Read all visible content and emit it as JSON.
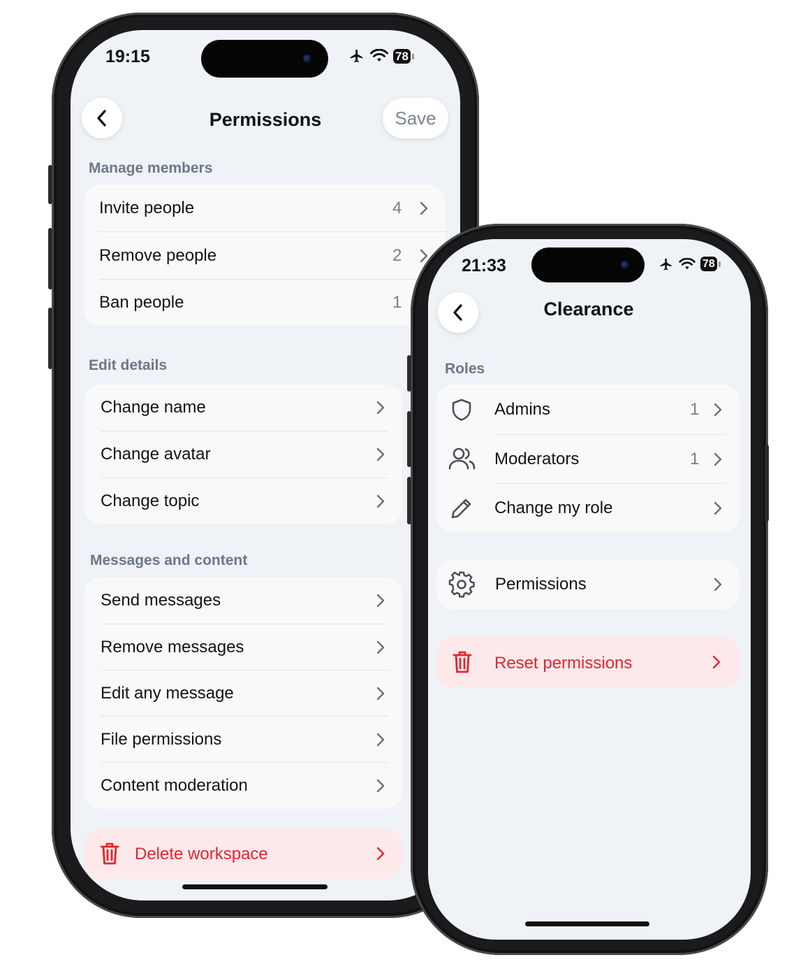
{
  "colors": {
    "danger": "#e3262e",
    "screen_bg": "#eff2f6",
    "card_bg": "#f9f9fa",
    "muted": "#6c7789"
  },
  "left_phone": {
    "status_time": "19:15",
    "battery": "78",
    "title": "Permissions",
    "save_label": "Save",
    "sections": [
      {
        "label": "Manage members",
        "items": [
          {
            "label": "Invite people",
            "count": "4"
          },
          {
            "label": "Remove people",
            "count": "2"
          },
          {
            "label": "Ban people",
            "count": "1"
          }
        ]
      },
      {
        "label": "Edit details",
        "items": [
          {
            "label": "Change name"
          },
          {
            "label": "Change avatar"
          },
          {
            "label": "Change topic"
          }
        ]
      },
      {
        "label": "Messages and content",
        "items": [
          {
            "label": "Send messages"
          },
          {
            "label": "Remove messages"
          },
          {
            "label": "Edit any message"
          },
          {
            "label": "File permissions"
          },
          {
            "label": "Content moderation"
          }
        ]
      }
    ],
    "danger_label": "Delete workspace"
  },
  "right_phone": {
    "status_time": "21:33",
    "battery": "78",
    "title": "Clearance",
    "roles_label": "Roles",
    "roles": [
      {
        "label": "Admins",
        "count": "1",
        "icon": "shield-icon"
      },
      {
        "label": "Moderators",
        "count": "1",
        "icon": "users-icon"
      },
      {
        "label": "Change my role",
        "icon": "pencil-icon"
      }
    ],
    "permissions_row": {
      "label": "Permissions",
      "icon": "gear-icon"
    },
    "danger_label": "Reset permissions",
    "danger_icon": "trash-icon"
  }
}
